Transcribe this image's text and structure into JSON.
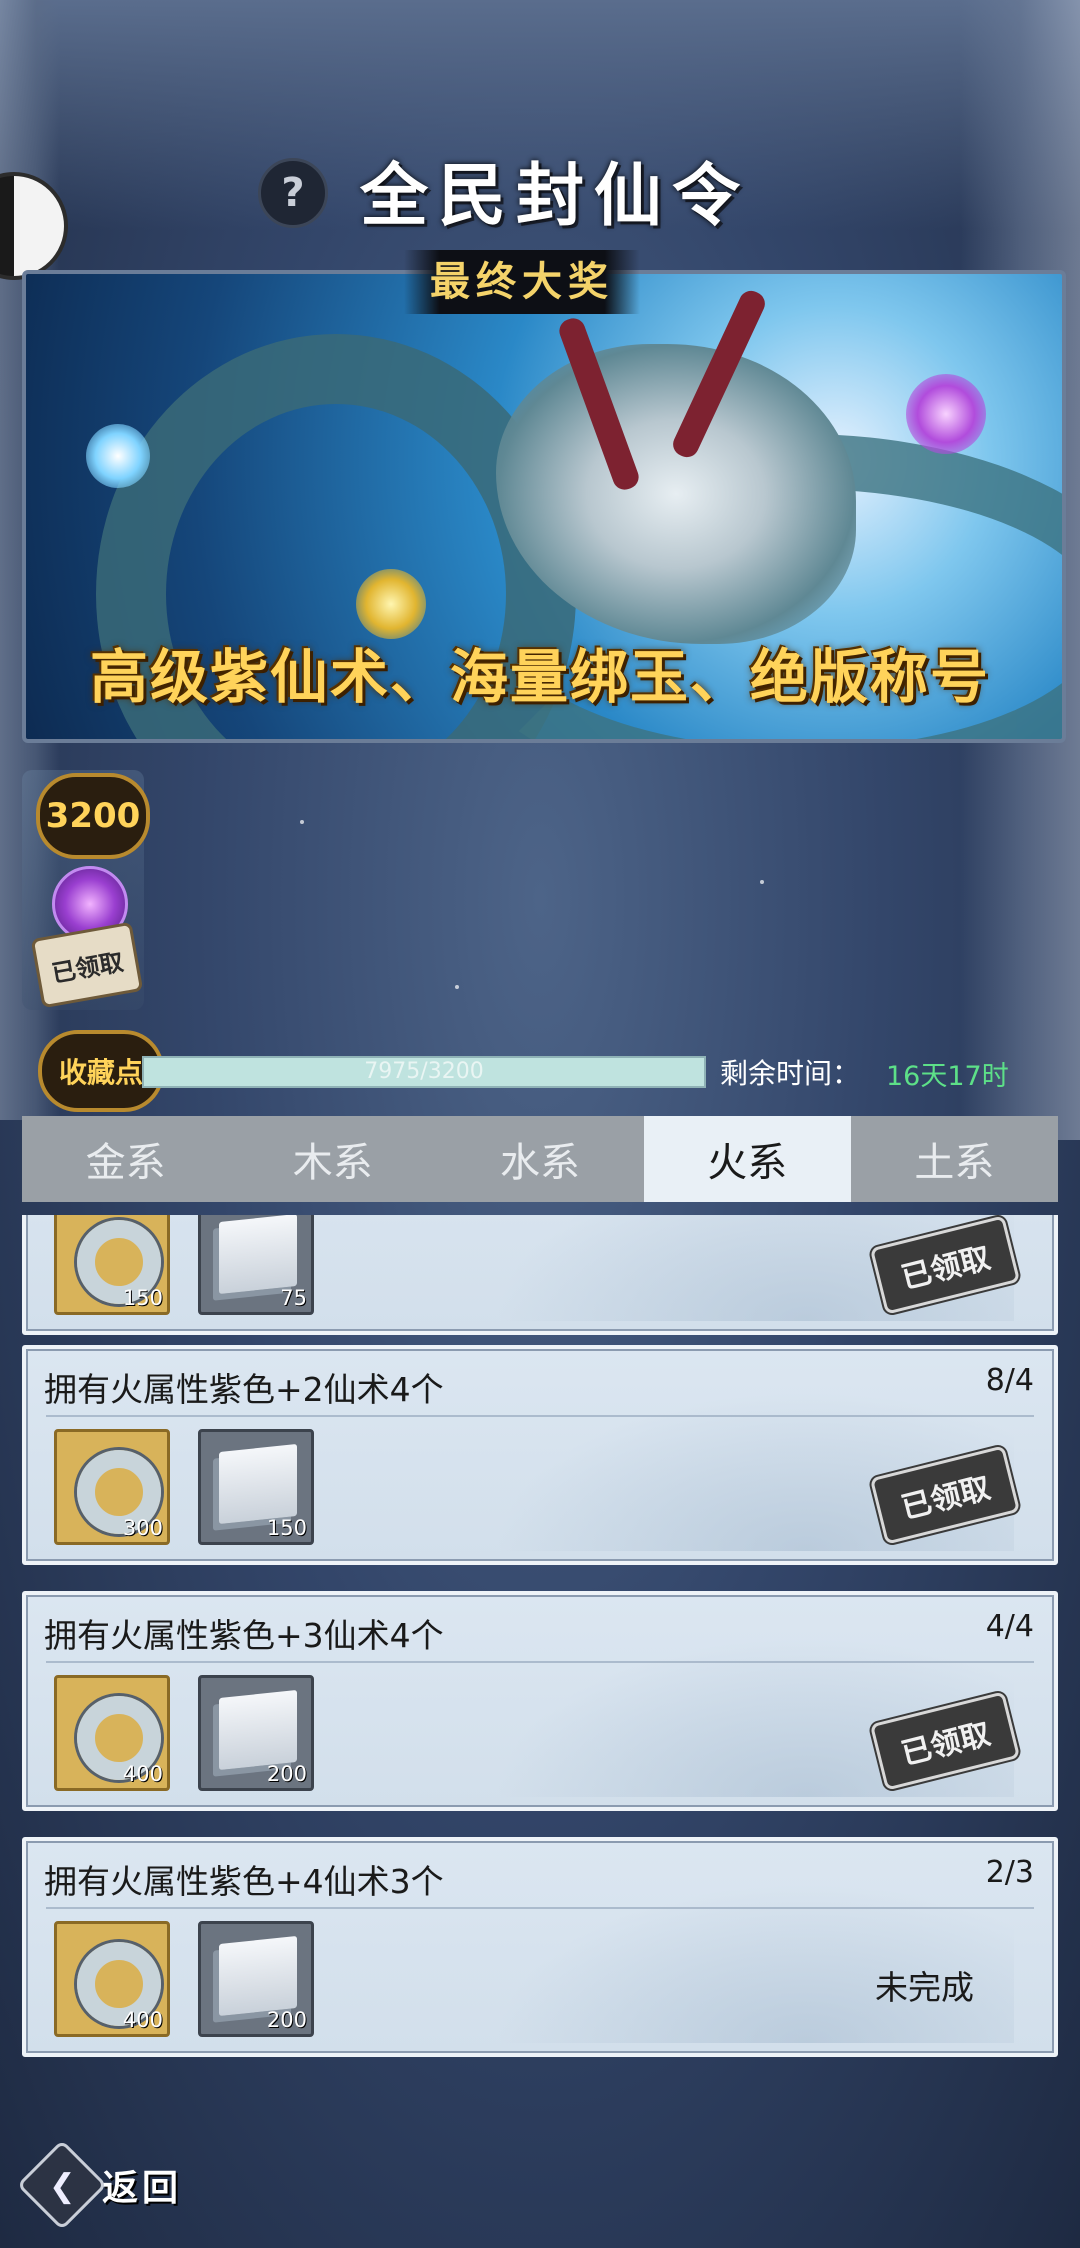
{
  "header": {
    "title": "全民封仙令",
    "help_icon": "?"
  },
  "banner": {
    "subtitle": "最终大奖",
    "main_text": "高级紫仙术、海量绑玉、绝版称号"
  },
  "milestone": {
    "points": "3200",
    "claimed_label": "已领取"
  },
  "progress": {
    "label": "收藏点",
    "text": "7975/3200",
    "fraction": 1.0,
    "time_label": "剩余时间：",
    "time_value": "16天17时"
  },
  "tabs": [
    {
      "label": "金系",
      "active": false
    },
    {
      "label": "木系",
      "active": false
    },
    {
      "label": "水系",
      "active": false
    },
    {
      "label": "火系",
      "active": true
    },
    {
      "label": "土系",
      "active": false
    }
  ],
  "tasks": [
    {
      "title": "",
      "count": "",
      "jade_qty": "150",
      "scroll_qty": "75",
      "status": "已领取",
      "claimed": true
    },
    {
      "title": "拥有火属性紫色+2仙术4个",
      "count": "8/4",
      "jade_qty": "300",
      "scroll_qty": "150",
      "status": "已领取",
      "claimed": true
    },
    {
      "title": "拥有火属性紫色+3仙术4个",
      "count": "4/4",
      "jade_qty": "400",
      "scroll_qty": "200",
      "status": "已领取",
      "claimed": true
    },
    {
      "title": "拥有火属性紫色+4仙术3个",
      "count": "2/3",
      "jade_qty": "400",
      "scroll_qty": "200",
      "status": "未完成",
      "claimed": false
    }
  ],
  "footer": {
    "back_label": "返回"
  },
  "colors": {
    "accent_gold": "#ffd35a",
    "time_green": "#5de088",
    "active_tab": "#e9f0f6"
  }
}
